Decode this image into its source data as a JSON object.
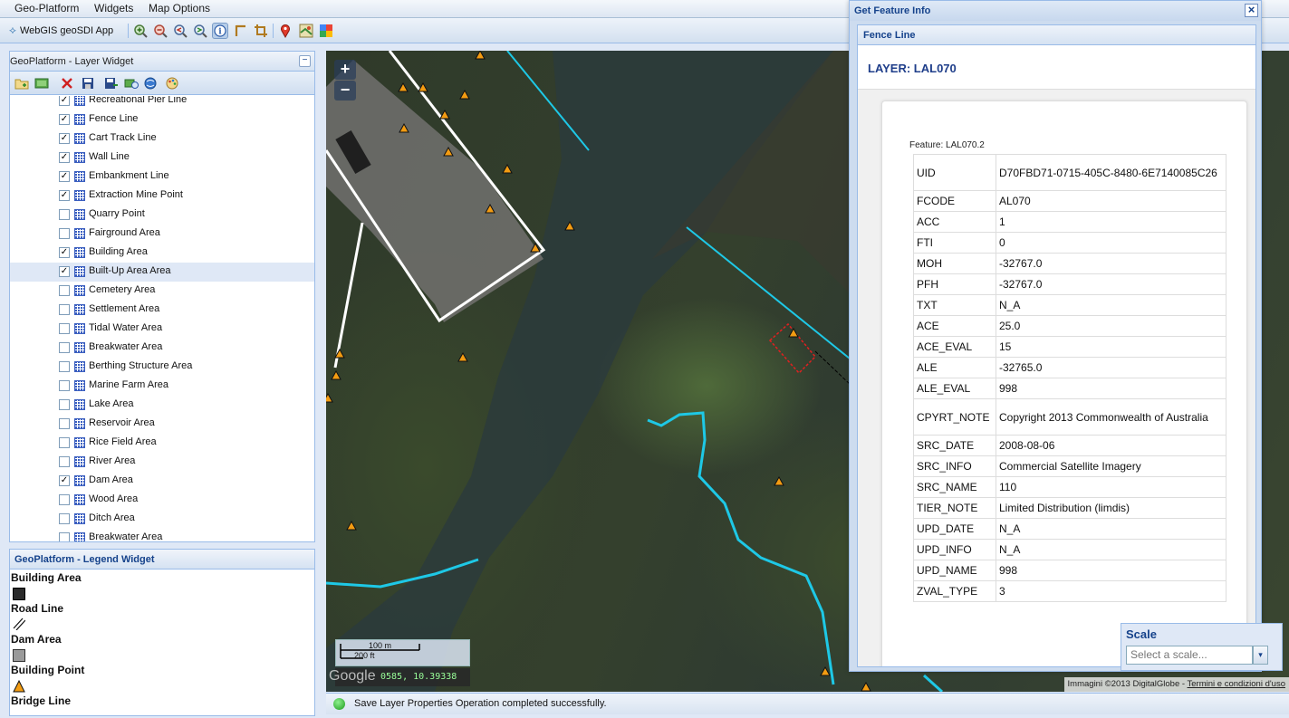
{
  "menu": [
    "Geo-Platform",
    "Widgets",
    "Map Options"
  ],
  "toolbar": {
    "app_title": "WebGIS geoSDI App",
    "icons": [
      "zoom-in-icon",
      "zoom-out-icon",
      "zoom-previous-icon",
      "zoom-next-icon",
      "info-icon",
      "measure-icon",
      "crop-icon",
      "marker-icon",
      "map-icon",
      "google-icon"
    ]
  },
  "layer_widget": {
    "title": "GeoPlatform - Layer Widget",
    "collapse": "−",
    "layers": [
      {
        "label": "Recreational Pier Line",
        "checked": true
      },
      {
        "label": "Fence Line",
        "checked": true
      },
      {
        "label": "Cart Track Line",
        "checked": true
      },
      {
        "label": "Wall Line",
        "checked": true
      },
      {
        "label": "Embankment Line",
        "checked": true
      },
      {
        "label": "Extraction Mine Point",
        "checked": true
      },
      {
        "label": "Quarry Point",
        "checked": false
      },
      {
        "label": "Fairground Area",
        "checked": false
      },
      {
        "label": "Building Area",
        "checked": true
      },
      {
        "label": "Built-Up Area Area",
        "checked": true,
        "selected": true
      },
      {
        "label": "Cemetery Area",
        "checked": false
      },
      {
        "label": "Settlement Area",
        "checked": false
      },
      {
        "label": "Tidal Water Area",
        "checked": false
      },
      {
        "label": "Breakwater Area",
        "checked": false
      },
      {
        "label": "Berthing Structure Area",
        "checked": false
      },
      {
        "label": "Marine Farm Area",
        "checked": false
      },
      {
        "label": "Lake Area",
        "checked": false
      },
      {
        "label": "Reservoir Area",
        "checked": false
      },
      {
        "label": "Rice Field Area",
        "checked": false
      },
      {
        "label": "River Area",
        "checked": false
      },
      {
        "label": "Dam Area",
        "checked": true
      },
      {
        "label": "Wood Area",
        "checked": false
      },
      {
        "label": "Ditch Area",
        "checked": false
      },
      {
        "label": "Breakwater Area",
        "checked": false
      }
    ]
  },
  "legend_widget": {
    "title": "GeoPlatform - Legend Widget",
    "items": [
      {
        "label": "Building Area",
        "symbol": "dark-square"
      },
      {
        "label": "Road Line",
        "symbol": "double-line"
      },
      {
        "label": "Dam Area",
        "symbol": "grey-square"
      },
      {
        "label": "Building Point",
        "symbol": "orange-triangle"
      },
      {
        "label": "Bridge Line",
        "symbol": "none"
      }
    ]
  },
  "map": {
    "zoom_in": "+",
    "zoom_out": "−",
    "scale_metric": "100 m",
    "scale_imperial": "200 ft",
    "coordinates": "0585, 10.39338",
    "google": "Google",
    "attribution": "Immagini ©2013 DigitalGlobe - ",
    "attribution_link": "Termini e condizioni d'uso"
  },
  "status": {
    "text": "Save Layer Properties Operation completed successfully."
  },
  "feature_info": {
    "title": "Get Feature Info",
    "close": "×",
    "tab": "Fence Line",
    "layer": "LAYER: LAL070",
    "feature": "Feature: LAL070.2",
    "rows": [
      [
        "UID",
        "D70FBD71-0715-405C-8480-6E7140085C26"
      ],
      [
        "FCODE",
        "AL070"
      ],
      [
        "ACC",
        "1"
      ],
      [
        "FTI",
        "0"
      ],
      [
        "MOH",
        "-32767.0"
      ],
      [
        "PFH",
        "-32767.0"
      ],
      [
        "TXT",
        "N_A"
      ],
      [
        "ACE",
        "25.0"
      ],
      [
        "ACE_EVAL",
        "15"
      ],
      [
        "ALE",
        "-32765.0"
      ],
      [
        "ALE_EVAL",
        "998"
      ],
      [
        "CPYRT_NOTE",
        "Copyright 2013 Commonwealth of Australia"
      ],
      [
        "SRC_DATE",
        "2008-08-06"
      ],
      [
        "SRC_INFO",
        "Commercial Satellite Imagery"
      ],
      [
        "SRC_NAME",
        "110"
      ],
      [
        "TIER_NOTE",
        "Limited Distribution (limdis)"
      ],
      [
        "UPD_DATE",
        "N_A"
      ],
      [
        "UPD_INFO",
        "N_A"
      ],
      [
        "UPD_NAME",
        "998"
      ],
      [
        "ZVAL_TYPE",
        "3"
      ]
    ]
  },
  "scale_widget": {
    "label": "Scale",
    "placeholder": "Select a scale...",
    "trigger": "▾"
  },
  "colors": {
    "accent": "#15428b",
    "panel_border": "#99bbe8",
    "river": "#1ec8e6",
    "building_point": "#f39c12"
  }
}
